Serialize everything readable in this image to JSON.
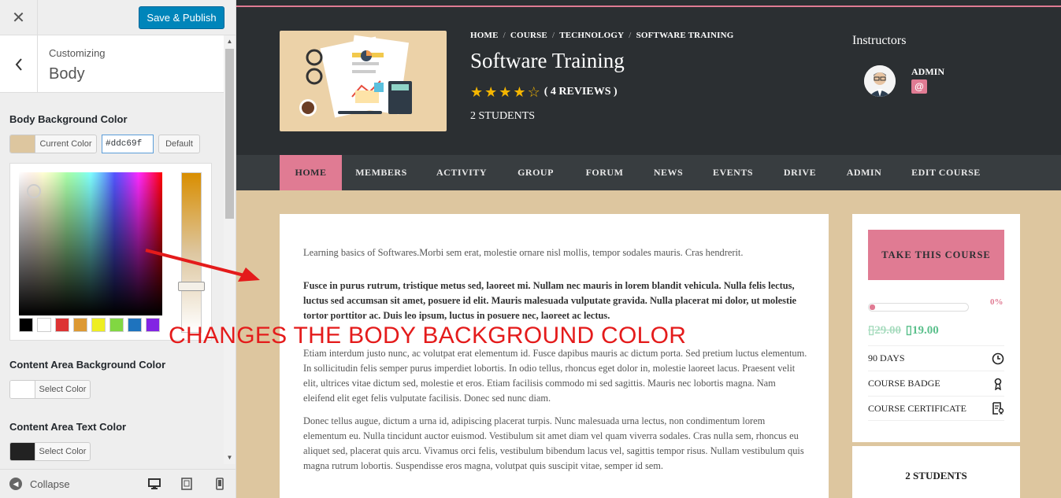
{
  "customizer": {
    "close_icon": "close-icon",
    "publish_label": "Save & Publish",
    "breadcrumb": "Customizing",
    "section_title": "Body",
    "body_bg": {
      "label": "Body Background Color",
      "current_label": "Current Color",
      "hex_value": "#ddc69f",
      "default_label": "Default",
      "color": "#ddc69f"
    },
    "palette": [
      "#000000",
      "#ffffff",
      "#dd3333",
      "#dd9933",
      "#eeee22",
      "#81d742",
      "#1e73be",
      "#8224e3"
    ],
    "content_bg": {
      "label": "Content Area Background Color",
      "select_label": "Select Color",
      "color": "#ffffff"
    },
    "content_text": {
      "label": "Content Area Text Color",
      "select_label": "Select Color",
      "color": "#222222"
    },
    "collapse_label": "Collapse"
  },
  "course": {
    "breadcrumbs": [
      "HOME",
      "COURSE",
      "TECHNOLOGY",
      "SOFTWARE TRAINING"
    ],
    "title": "Software Training",
    "rating": 4,
    "reviews_label": "( 4 REVIEWS )",
    "students_label": "2 STUDENTS",
    "instructors_heading": "Instructors",
    "instructor_name": "ADMIN",
    "instructor_badge": "@"
  },
  "nav": [
    "HOME",
    "MEMBERS",
    "ACTIVITY",
    "GROUP",
    "FORUM",
    "NEWS",
    "EVENTS",
    "DRIVE",
    "ADMIN",
    "EDIT COURSE"
  ],
  "content": {
    "p1": "Learning basics of Softwares.Morbi sem erat, molestie ornare nisl mollis, tempor sodales mauris. Cras hendrerit.",
    "p2": "Fusce in purus rutrum, tristique metus sed, laoreet mi. Nullam nec mauris in lorem blandit vehicula. Nulla felis lectus, luctus sed accumsan sit amet, posuere id elit. Mauris malesuada vulputate gravida. Nulla placerat mi dolor, ut molestie tortor porttitor ac. Duis leo ipsum, luctus in posuere nec, laoreet ac lectus.",
    "p3": "Etiam interdum justo nunc, ac volutpat erat elementum id. Fusce dapibus mauris ac dictum porta. Sed pretium luctus elementum. In sollicitudin felis semper purus imperdiet lobortis. In odio tellus, rhoncus eget dolor in, molestie laoreet lacus. Praesent velit elit, ultrices vitae dictum sed, molestie et eros. Etiam facilisis commodo mi sed sagittis. Mauris nec lobortis magna. Nam eleifend elit eget felis vulputate facilisis. Donec sed nunc diam.",
    "p4": "Donec tellus augue, dictum a urna id, adipiscing placerat turpis. Nunc malesuada urna lectus, non condimentum lorem elementum eu. Nulla tincidunt auctor euismod. Vestibulum sit amet diam vel quam viverra sodales. Cras nulla sem, rhoncus eu aliquet sed, placerat quis arcu. Vivamus orci felis, vestibulum bibendum lacus vel, sagittis tempor risus. Nullam vestibulum quis magna rutrum lobortis. Suspendisse eros magna, volutpat quis suscipit vitae, semper id sem."
  },
  "sidebar": {
    "take_course_label": "TAKE THIS COURSE",
    "progress_percent": 0,
    "progress_label": "0%",
    "price_old": "29.00",
    "price_new": "19.00",
    "features": [
      {
        "label": "90 DAYS",
        "icon": "clock-icon"
      },
      {
        "label": "COURSE BADGE",
        "icon": "badge-icon"
      },
      {
        "label": "COURSE CERTIFICATE",
        "icon": "certificate-icon"
      }
    ],
    "students_label": "2 STUDENTS"
  },
  "annotation": {
    "text": "CHANGES THE BODY BACKGROUND COLOR",
    "color": "#e41b1b"
  },
  "colors": {
    "accent_pink": "#e07b93",
    "hero_bg": "#2b2f32",
    "nav_bg": "#383d40",
    "wp_blue": "#0085ba"
  }
}
